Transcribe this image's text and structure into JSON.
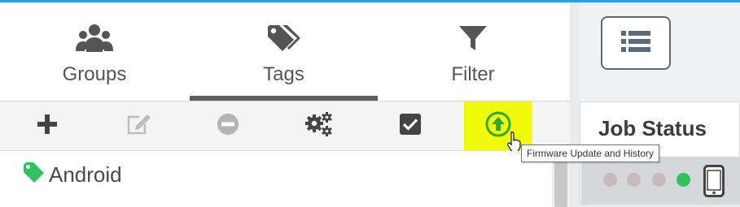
{
  "tabs": [
    {
      "label": "Groups",
      "icon": "users-icon"
    },
    {
      "label": "Tags",
      "icon": "tags-icon"
    },
    {
      "label": "Filter",
      "icon": "filter-icon"
    }
  ],
  "active_tab": "Tags",
  "toolbar": {
    "buttons": [
      {
        "icon": "plus-icon",
        "enabled": true
      },
      {
        "icon": "edit-icon",
        "enabled": false
      },
      {
        "icon": "minus-circle-icon",
        "enabled": false
      },
      {
        "icon": "gears-icon",
        "enabled": true
      },
      {
        "icon": "checkbox-icon",
        "enabled": true
      },
      {
        "icon": "upload-circle-icon",
        "enabled": true,
        "highlighted": true
      }
    ],
    "tooltip": "Firmware Update and History"
  },
  "tree": {
    "items": [
      {
        "label": "Android",
        "icon": "tag-icon",
        "icon_color": "#2ec45c"
      }
    ]
  },
  "right_panel": {
    "list_button_icon": "list-icon",
    "job_status_title": "Job Status",
    "status_dot_colors": [
      "#c9b9bd",
      "#c9b9bd",
      "#c9b9bd",
      "#2ec45c"
    ],
    "device_icon": "mobile-icon"
  },
  "colors": {
    "accent_bar": "#2e9be6",
    "highlight": "#f2fa0b",
    "firmware_icon": "#2ea82e",
    "tag_green": "#2ec45c"
  }
}
